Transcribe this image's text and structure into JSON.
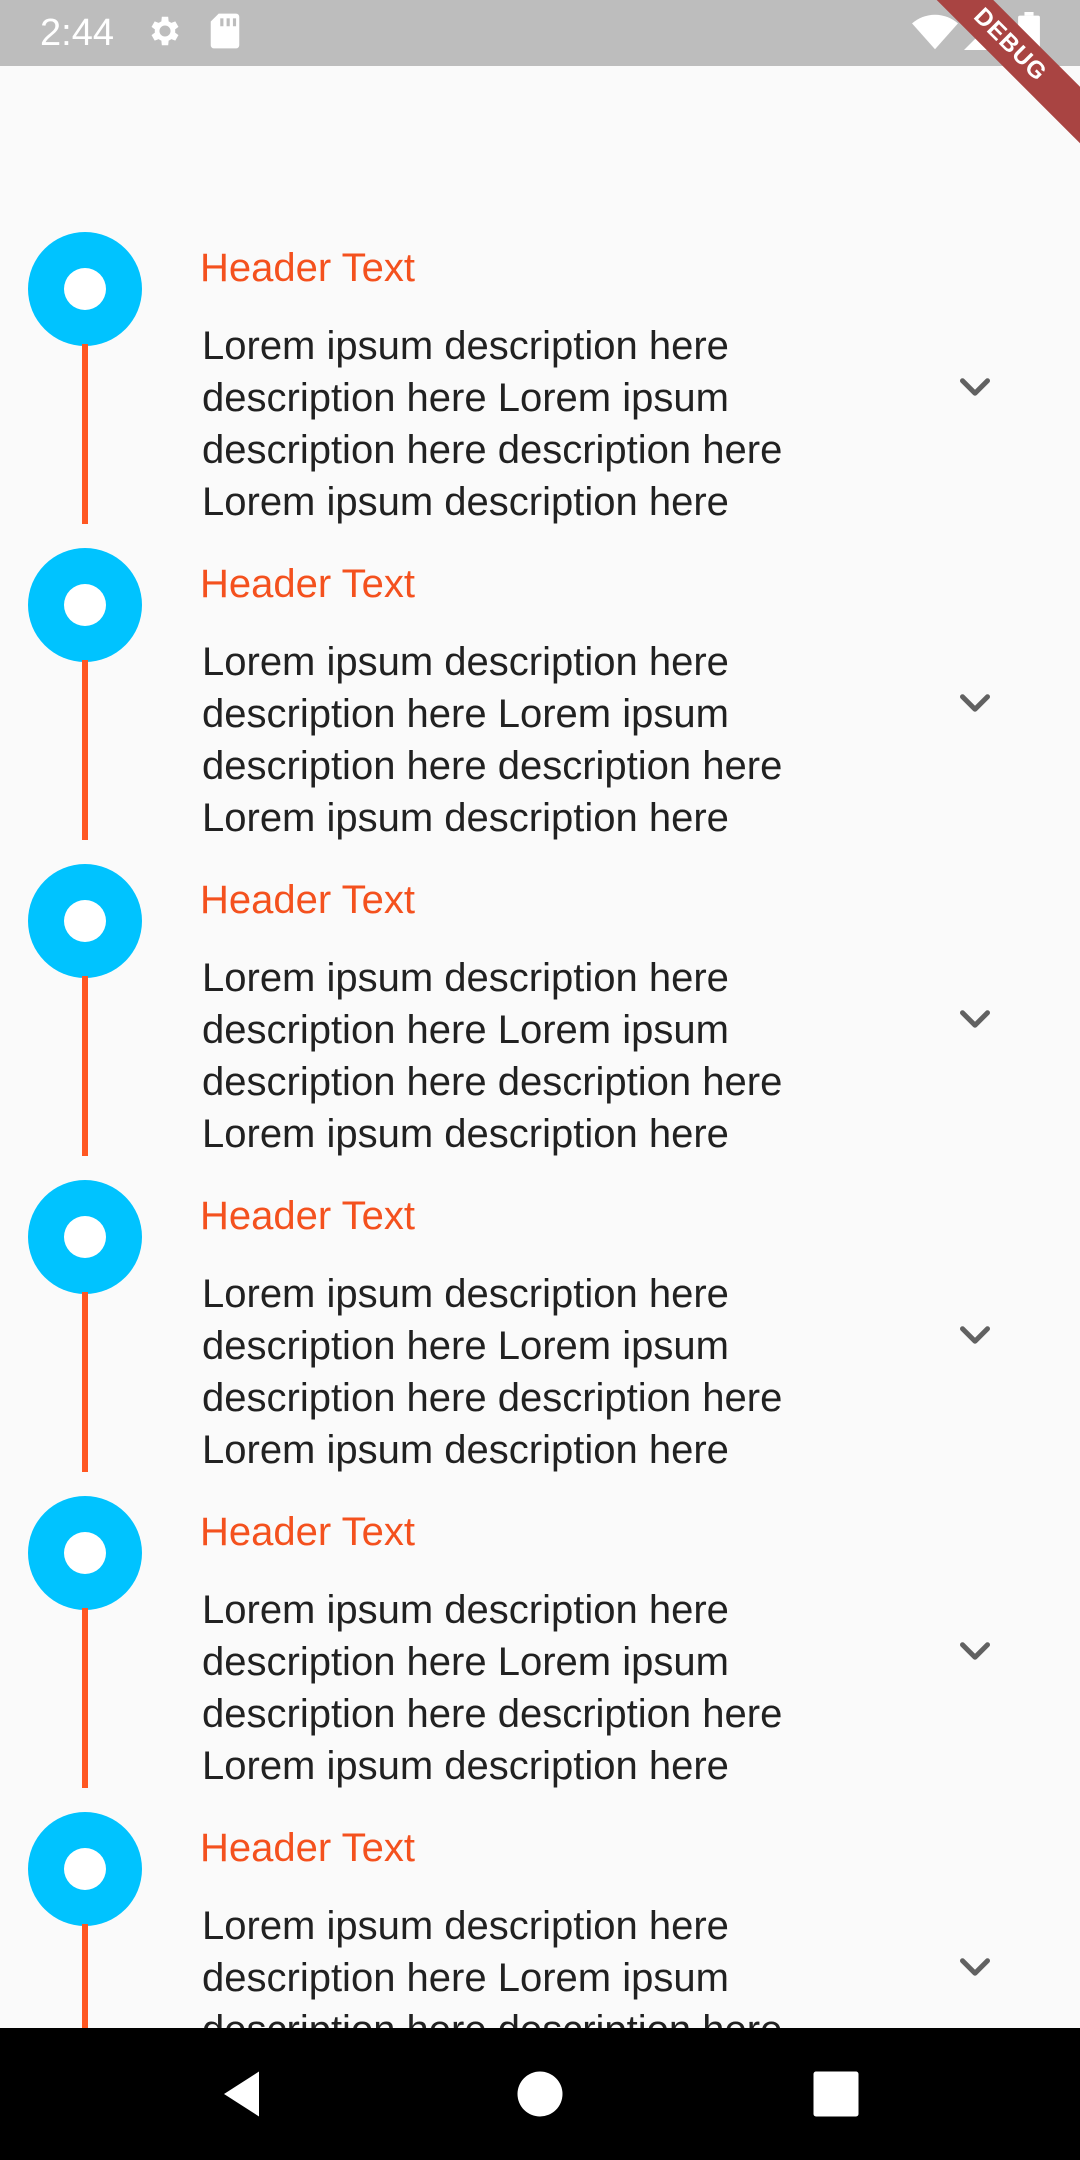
{
  "status_bar": {
    "time": "2:44",
    "icons": [
      "gear-icon",
      "sd-card-icon",
      "wifi-icon",
      "signal-icon",
      "battery-icon"
    ],
    "debug_label": "DEBUG"
  },
  "colors": {
    "accent_node": "#00c3ff",
    "timeline_line": "#ff5722",
    "header_text": "#f4511e"
  },
  "timeline": {
    "items": [
      {
        "header": "Header Text",
        "description": "Lorem ipsum description here description here Lorem ipsum description here description here Lorem ipsum description here",
        "expand_icon": "chevron-down-icon"
      },
      {
        "header": "Header Text",
        "description": "Lorem ipsum description here description here Lorem ipsum description here description here Lorem ipsum description here",
        "expand_icon": "chevron-down-icon"
      },
      {
        "header": "Header Text",
        "description": "Lorem ipsum description here description here Lorem ipsum description here description here Lorem ipsum description here",
        "expand_icon": "chevron-down-icon"
      },
      {
        "header": "Header Text",
        "description": "Lorem ipsum description here description here Lorem ipsum description here description here Lorem ipsum description here",
        "expand_icon": "chevron-down-icon"
      },
      {
        "header": "Header Text",
        "description": "Lorem ipsum description here description here Lorem ipsum description here description here Lorem ipsum description here",
        "expand_icon": "chevron-down-icon"
      },
      {
        "header": "Header Text",
        "description": "Lorem ipsum description here description here Lorem ipsum description here description here Lorem ipsum description here",
        "expand_icon": "chevron-down-icon"
      }
    ]
  },
  "nav_bar": {
    "buttons": [
      "back-icon",
      "home-icon",
      "recents-icon"
    ]
  }
}
